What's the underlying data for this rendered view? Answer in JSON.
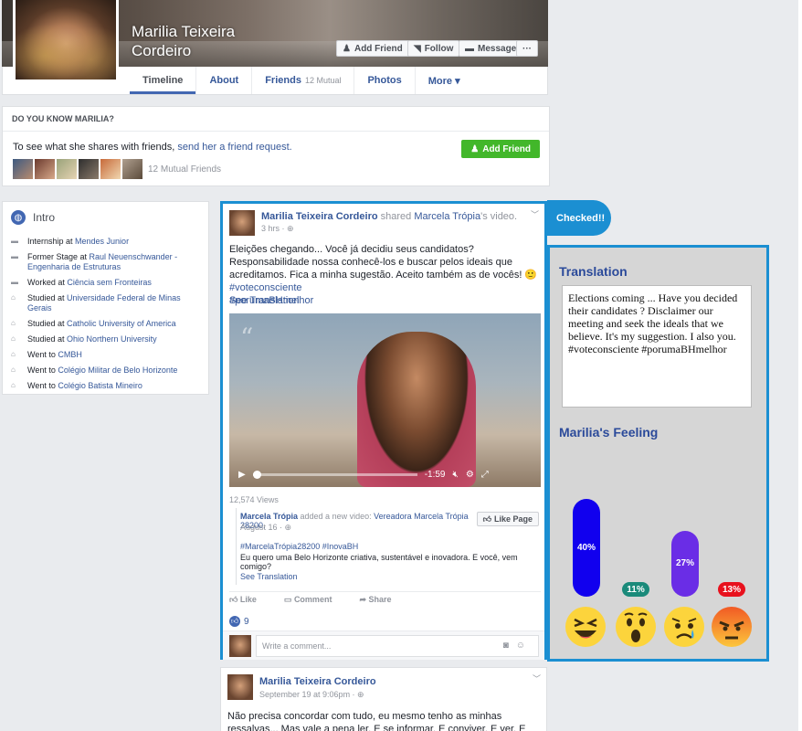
{
  "profile": {
    "name": "Marilia Teixeira Cordeiro",
    "buttons": {
      "add_friend": "Add Friend",
      "follow": "Follow",
      "message": "Message",
      "more": "···"
    },
    "tabs": [
      {
        "label": "Timeline"
      },
      {
        "label": "About"
      },
      {
        "label": "Friends",
        "extra": "12 Mutual"
      },
      {
        "label": "Photos"
      },
      {
        "label": "More ▾"
      }
    ]
  },
  "know": {
    "title": "DO YOU KNOW MARILIA?",
    "text_before": "To see what she shares with friends, ",
    "link": "send her a friend request.",
    "button": "Add Friend",
    "mutual": "12 Mutual Friends"
  },
  "intro": {
    "title": "Intro",
    "items": [
      {
        "pre": "Internship at ",
        "link": "Mendes Junior"
      },
      {
        "pre": "Former Stage at ",
        "link": "Raul Neuenschwander - Engenharia de Estruturas"
      },
      {
        "pre": "Worked at ",
        "link": "Ciência sem Fronteiras"
      },
      {
        "pre": "Studied at ",
        "link": "Universidade Federal de Minas Gerais"
      },
      {
        "pre": "Studied at ",
        "link": "Catholic University of America"
      },
      {
        "pre": "Studied at ",
        "link": "Ohio Northern University"
      },
      {
        "pre": "Went to ",
        "link": "CMBH"
      },
      {
        "pre": "Went to ",
        "link": "Colégio Militar de Belo Horizonte"
      },
      {
        "pre": "Went to ",
        "link": "Colégio Batista Mineiro"
      }
    ]
  },
  "post": {
    "author": "Marilia Teixeira Cordeiro",
    "shared": " shared ",
    "page": "Marcela Trópia",
    "suffix": "'s video.",
    "time": "3 hrs · ⊕",
    "text": "Eleições chegando... Você já decidiu seus candidatos? Responsabilidade nossa conhecê-los e buscar pelos ideais que acreditamos. Fica a minha sugestão. Aceito também as de vocês! 🙂 ",
    "tag1": "#voteconsciente",
    "tag2": "#porumaBHmelhor",
    "see_translation": "See Translation",
    "video_time": "-1:59",
    "views": "12,574 Views",
    "shared_page": "Marcela Trópia",
    "shared_action": " added a new video: ",
    "shared_video": "Vereadora Marcela Trópia 28200.",
    "shared_date": "August 16 · ⊕",
    "like_page": "Like Page",
    "shared_tags": "#MarcelaTrópia28200 #InovaBH",
    "shared_body": "Eu quero uma Belo Horizonte criativa, sustentável e inovadora. E você, vem comigo?",
    "shared_translation": "See Translation",
    "actions": {
      "like": "Like",
      "comment": "Comment",
      "share": "Share"
    },
    "likes": "9",
    "comment_placeholder": "Write a comment..."
  },
  "post2": {
    "author": "Marilia Teixeira Cordeiro",
    "time": "September 19 at 9:06pm · ⊕",
    "text": "Não precisa concordar com tudo, eu mesmo tenho as minhas ressalvas... Mas vale a pena ler. E se informar. E conviver. E ver. E reviver."
  },
  "badge": {
    "label": "Checked!!"
  },
  "panel": {
    "translation_title": "Translation",
    "translation_text": "Elections coming ...  Have you decided their candidates ?  Disclaimer our meeting and seek the ideals that we believe.  It's my suggestion.  I also you.  #voteconsciente #porumaBHmelhor",
    "feeling_title": "Marilia's Feeling",
    "feelings": [
      {
        "emotion": "laughing",
        "value": 40,
        "label": "40%",
        "color": "#1100ee"
      },
      {
        "emotion": "surprised",
        "value": 11,
        "label": "11%",
        "color": "#1a8a7a"
      },
      {
        "emotion": "sad",
        "value": 27,
        "label": "27%",
        "color": "#6a2de6"
      },
      {
        "emotion": "angry",
        "value": 13,
        "label": "13%",
        "color": "#e8111d"
      }
    ]
  }
}
